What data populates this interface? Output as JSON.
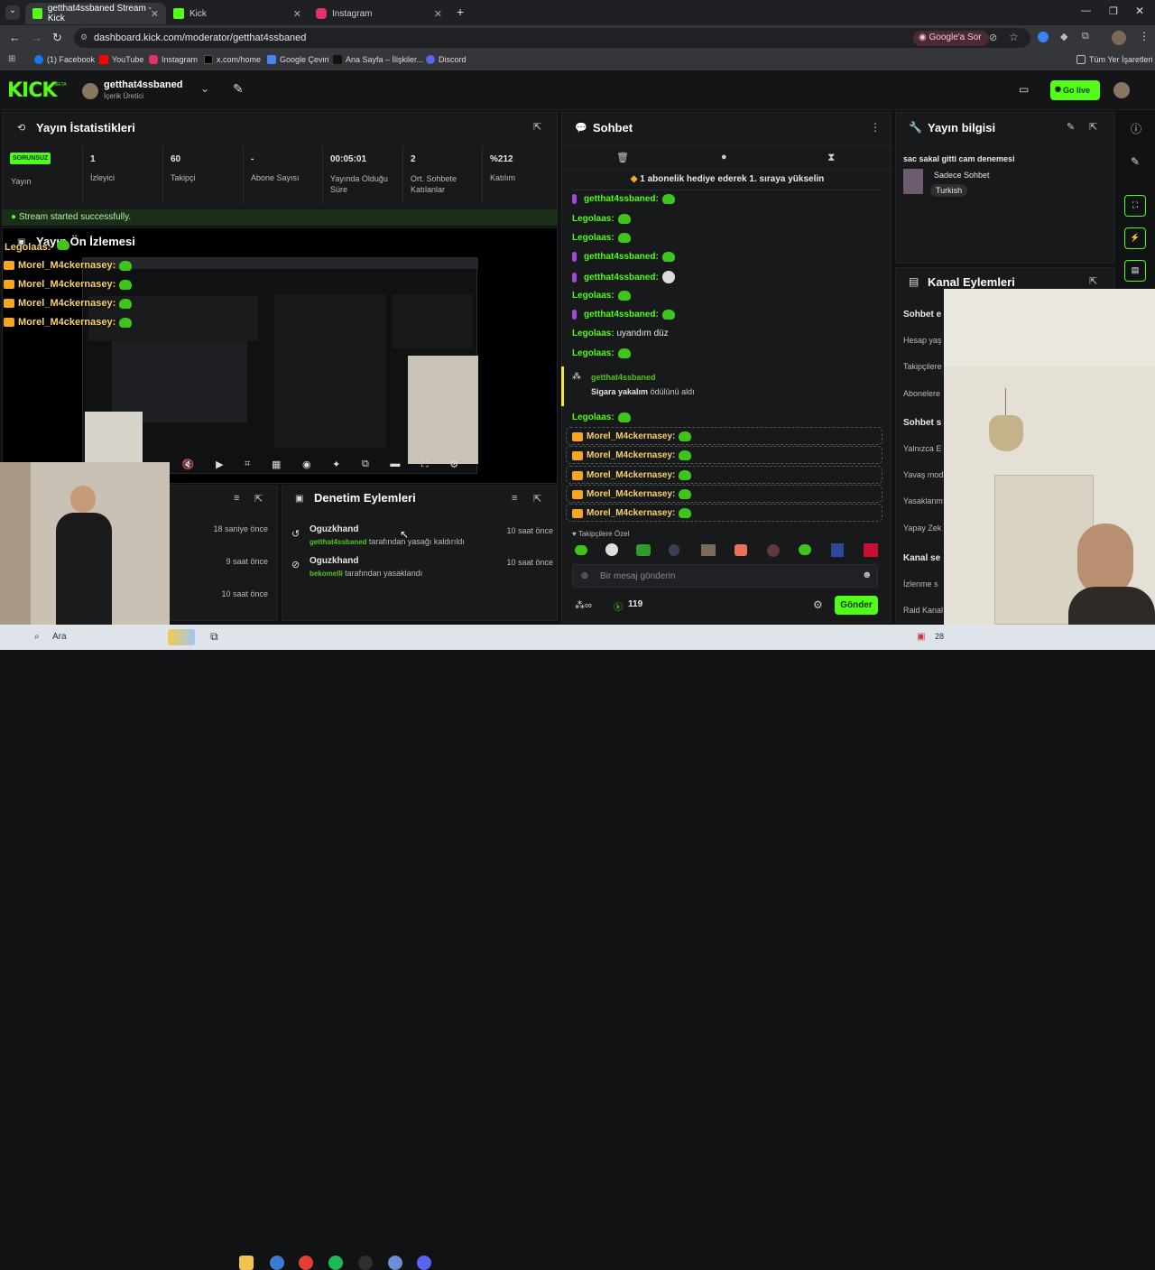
{
  "browser": {
    "tabs": [
      {
        "title": "getthat4ssbaned Stream - Kick",
        "color": "#53fc18"
      },
      {
        "title": "Kick",
        "color": "#53fc18"
      },
      {
        "title": "Instagram",
        "color": "#e1306c"
      }
    ],
    "url": "dashboard.kick.com/moderator/getthat4ssbaned",
    "google_btn": "Google'a Sor",
    "bookmarks": [
      "(1) Facebook",
      "YouTube",
      "Instagram",
      "x.com/home",
      "Google Çeviri",
      "Ana Sayfa – İlişkiler...",
      "Discord"
    ],
    "all_bookmarks": "Tüm Yer İşaretleri"
  },
  "kick": {
    "logo": "KICK",
    "beta": "BETA",
    "channel_name": "getthat4ssbaned",
    "channel_role": "İçerik Üretici",
    "go_live": "Go live"
  },
  "stats": {
    "title": "Yayın İstatistikleri",
    "status_badge": "SORUNSUZ",
    "status_label": "Yayın",
    "items": [
      {
        "value": "1",
        "label": "İzleyici"
      },
      {
        "value": "60",
        "label": "Takipçi"
      },
      {
        "value": "-",
        "label": "Abone Sayısı"
      },
      {
        "value": "00:05:01",
        "label": "Yayında Olduğu Süre"
      },
      {
        "value": "2",
        "label": "Ort. Sohbete Katılanlar"
      },
      {
        "value": "%212",
        "label": "Katılım"
      }
    ],
    "success": "Stream started successfully."
  },
  "preview": {
    "title": "Yayın Ön İzlemesi"
  },
  "overlay_chat": [
    {
      "user": "Legolaas"
    },
    {
      "user": "Morel_M4ckernasey"
    },
    {
      "user": "Morel_M4ckernasey"
    },
    {
      "user": "Morel_M4ckernasey"
    },
    {
      "user": "Morel_M4ckernasey"
    }
  ],
  "left_log": {
    "times": [
      "18 saniye önce",
      "9 saat önce",
      "10 saat önce"
    ]
  },
  "moderation": {
    "title": "Denetim Eylemleri",
    "items": [
      {
        "user": "Oguzkhand",
        "actor": "getthat4ssbaned",
        "action": "tarafından yasağı kaldırıldı",
        "time": "10 saat önce"
      },
      {
        "user": "Oguzkhand",
        "actor": "bekomelli",
        "action": "tarafından yasaklandı",
        "time": "10 saat önce"
      }
    ]
  },
  "chat": {
    "title": "Sohbet",
    "pinned": "1 abonelik hediye ederek 1. sıraya yükselin",
    "messages": [
      {
        "user": "getthat4ssbaned:",
        "text": "",
        "kind": "mod"
      },
      {
        "user": "Legolaas:",
        "text": "",
        "kind": "plain"
      },
      {
        "user": "Legolaas:",
        "text": "",
        "kind": "plain"
      },
      {
        "user": "getthat4ssbaned:",
        "text": "",
        "kind": "mod"
      },
      {
        "user": "getthat4ssbaned:",
        "text": "",
        "kind": "mod"
      },
      {
        "user": "Legolaas:",
        "text": "",
        "kind": "plain"
      },
      {
        "user": "getthat4ssbaned:",
        "text": "",
        "kind": "mod"
      },
      {
        "user": "Legolaas:",
        "text": "uyandım düz",
        "kind": "plain"
      },
      {
        "user": "Legolaas:",
        "text": "",
        "kind": "plain"
      }
    ],
    "reward_user": "getthat4ssbaned",
    "reward_name": "Sigara yakalım",
    "reward_suffix": "ödülünü aldı",
    "after_reward": "Legolaas:",
    "sub_user": "Morel_M4ckernasey:",
    "emote_label": "Takipçilere Özel",
    "input_placeholder": "Bir mesaj gönderin",
    "points": "119",
    "send": "Gönder"
  },
  "stream_info": {
    "title": "Yayın bilgisi",
    "stream_title": "sac sakal gitti cam denemesi",
    "category": "Sadece Sohbet",
    "tag": "Turkish"
  },
  "channel_actions": {
    "title": "Kanal Eylemleri",
    "section1": "Sohbet e",
    "rows1": [
      "Hesap yaş",
      "Takipçilere",
      "Abonelere"
    ],
    "section2": "Sohbet s",
    "rows2": [
      "Yalnızca E",
      "Yavaş mod",
      "Yasaklanm",
      "Yapay Zek"
    ],
    "section3": "Kanal se",
    "rows3": [
      "İzlenme s",
      "Raid Kanal"
    ]
  },
  "taskbar": {
    "search": "Ara",
    "date_fragment": "28"
  }
}
